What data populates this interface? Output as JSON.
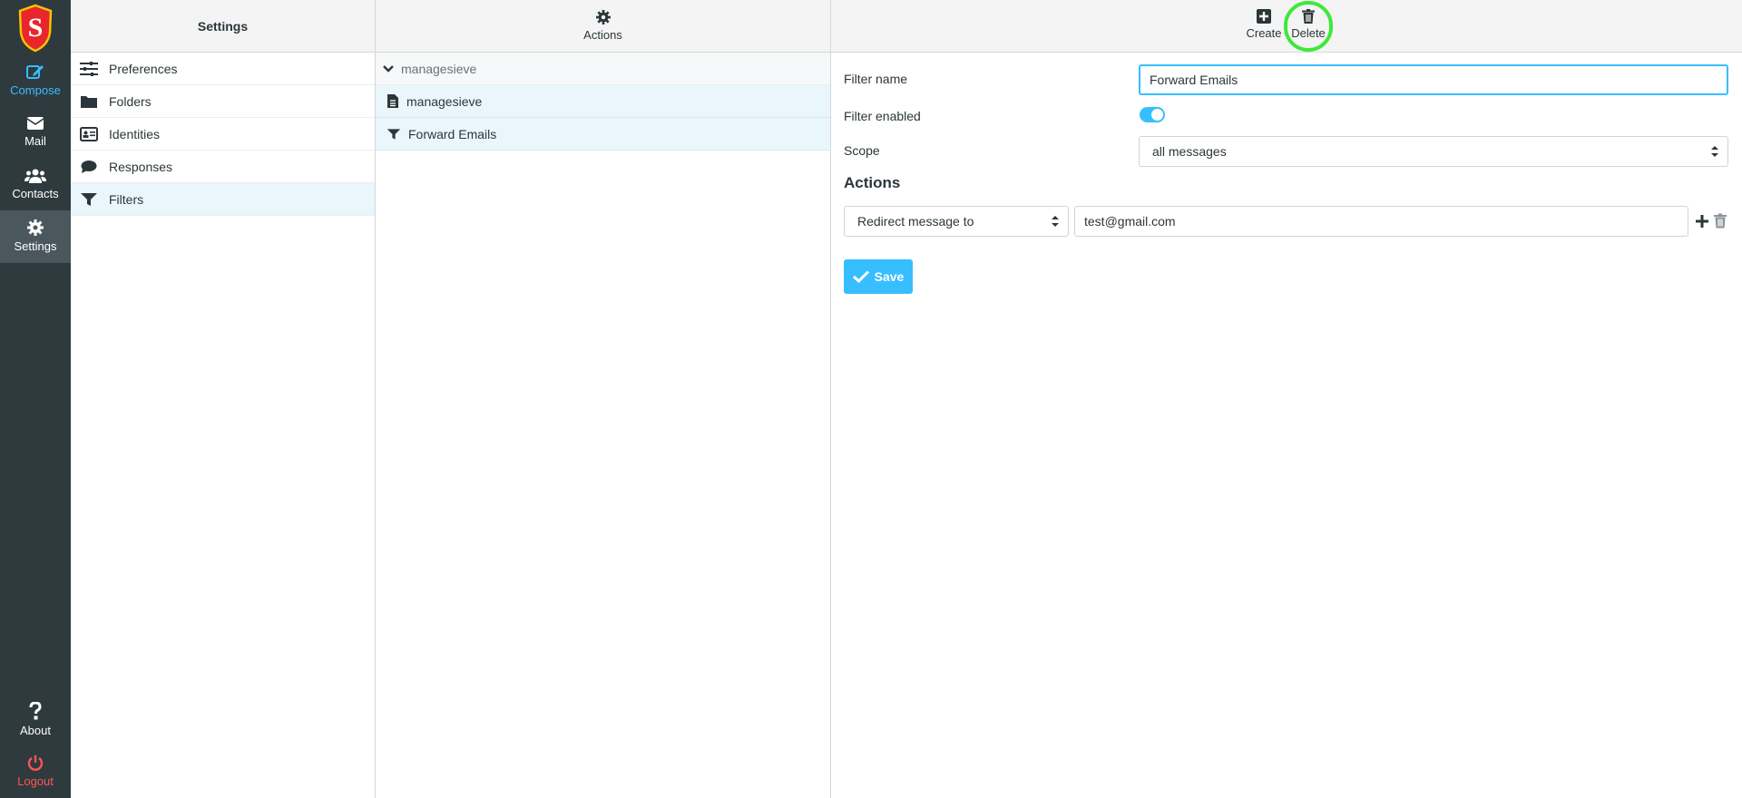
{
  "nav": {
    "compose": "Compose",
    "mail": "Mail",
    "contacts": "Contacts",
    "settings": "Settings",
    "about": "About",
    "logout": "Logout"
  },
  "settings_col": {
    "title": "Settings",
    "items": [
      {
        "label": "Preferences",
        "icon": "sliders-icon"
      },
      {
        "label": "Folders",
        "icon": "folder-icon"
      },
      {
        "label": "Identities",
        "icon": "id-card-icon"
      },
      {
        "label": "Responses",
        "icon": "comment-icon"
      },
      {
        "label": "Filters",
        "icon": "filter-icon",
        "active": true
      }
    ]
  },
  "filters_col": {
    "actions_label": "Actions",
    "group": "managesieve",
    "rows": [
      {
        "label": "managesieve",
        "icon": "file-icon"
      },
      {
        "label": "Forward Emails",
        "icon": "filter-icon"
      }
    ]
  },
  "toolbar": {
    "create_label": "Create",
    "delete_label": "Delete"
  },
  "form": {
    "filter_name_label": "Filter name",
    "filter_name_value": "Forward Emails",
    "filter_enabled_label": "Filter enabled",
    "filter_enabled": true,
    "scope_label": "Scope",
    "scope_value": "all messages",
    "actions_title": "Actions",
    "action_type": "Redirect message to",
    "action_target": "test@gmail.com",
    "save_label": "Save"
  },
  "colors": {
    "accent": "#37beff",
    "sidebar": "#2f3a3f",
    "logout": "#ff5552",
    "highlight": "#3fe83a"
  }
}
